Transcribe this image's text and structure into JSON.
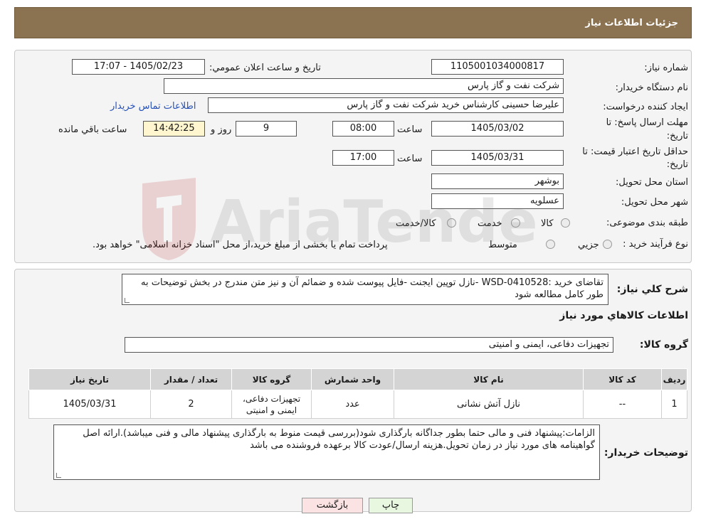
{
  "header": {
    "title": "جزئیات اطلاعات نیاز"
  },
  "fields": {
    "need_number_label": "شماره نیاز:",
    "need_number": "1105001034000817",
    "announce_label": "تاریخ و ساعت اعلان عمومي:",
    "announce_value": "1405/02/23 - 17:07",
    "buyer_org_label": "نام دستگاه خریدار:",
    "buyer_org": "شرکت نفت و گاز پارس",
    "creator_label": "ایجاد کننده درخواست:",
    "creator": "علیرضا حسینی کارشناس خرید شرکت نفت و گاز پارس",
    "contact_link": "اطلاعات تماس خریدار",
    "deadline_label_1": "مهلت ارسال پاسخ: تا",
    "deadline_label_2": "تاریخ:",
    "deadline_date": "1405/03/02",
    "time_label": "ساعت",
    "deadline_time": "08:00",
    "days_value": "9",
    "days_label": "روز و",
    "remaining_time": "14:42:25",
    "remaining_label": "ساعت باقي مانده",
    "validity_label_1": "حداقل تاریخ اعتبار قیمت: تا",
    "validity_label_2": "تاریخ:",
    "validity_date": "1405/03/31",
    "validity_time": "17:00",
    "province_label": "استان محل تحویل:",
    "province": "بوشهر",
    "city_label": "شهر محل تحویل:",
    "city": "عسلویه",
    "category_label": "طبقه بندی موضوعی:",
    "category_options": [
      "کالا",
      "خدمت",
      "کالا/خدمت"
    ],
    "process_label": "نوع فرآیند خرید :",
    "process_options": [
      "جزيي",
      "متوسط"
    ],
    "process_note": "پرداخت تمام یا بخشی از مبلغ خرید،از محل \"اسناد خزانه اسلامی\" خواهد بود."
  },
  "description": {
    "label": "شرح کلي نیاز:",
    "text": "تقاضای خرید :WSD-0410528 -نازل توپین ایجنت -فایل پیوست شده و ضمائم آن و نیز متن مندرج در بخش توضیحات به طور کامل مطالعه شود"
  },
  "goods_section": {
    "title": "اطلاعات کالاهاي مورد نیاز",
    "group_label": "گروه کالا:",
    "group_value": "تجهیزات دفاعی، ایمنی و امنیتی"
  },
  "table": {
    "headers": [
      "ردیف",
      "کد کالا",
      "نام کالا",
      "واحد شمارش",
      "گروه کالا",
      "تعداد / مقدار",
      "تاریخ نیاز"
    ],
    "rows": [
      [
        "1",
        "--",
        "نازل آتش نشانی",
        "عدد",
        "تجهیزات دفاعی، ایمنی و امنیتی",
        "2",
        "1405/03/31"
      ]
    ]
  },
  "buyer_notes": {
    "label": "توضیحات خریدار:",
    "text": "الزامات:پیشنهاد فنی و مالی حتما  بطور جداگانه بارگذاری شود(بررسی قیمت منوط به بارگذاری پیشنهاد مالی و فنی میباشد).ارائه اصل گواهینامه های مورد نیاز در زمان تحویل.هزینه ارسال/عودت کالا برعهده فروشنده می باشد"
  },
  "buttons": {
    "print": "چاپ",
    "back": "بازگشت"
  },
  "watermark": {
    "text": "AriaTender.neT"
  },
  "colors": {
    "header_bg": "#8b7250",
    "link": "#2651b8",
    "print_btn": "#e8f7e0",
    "back_btn": "#fbe3e3"
  }
}
